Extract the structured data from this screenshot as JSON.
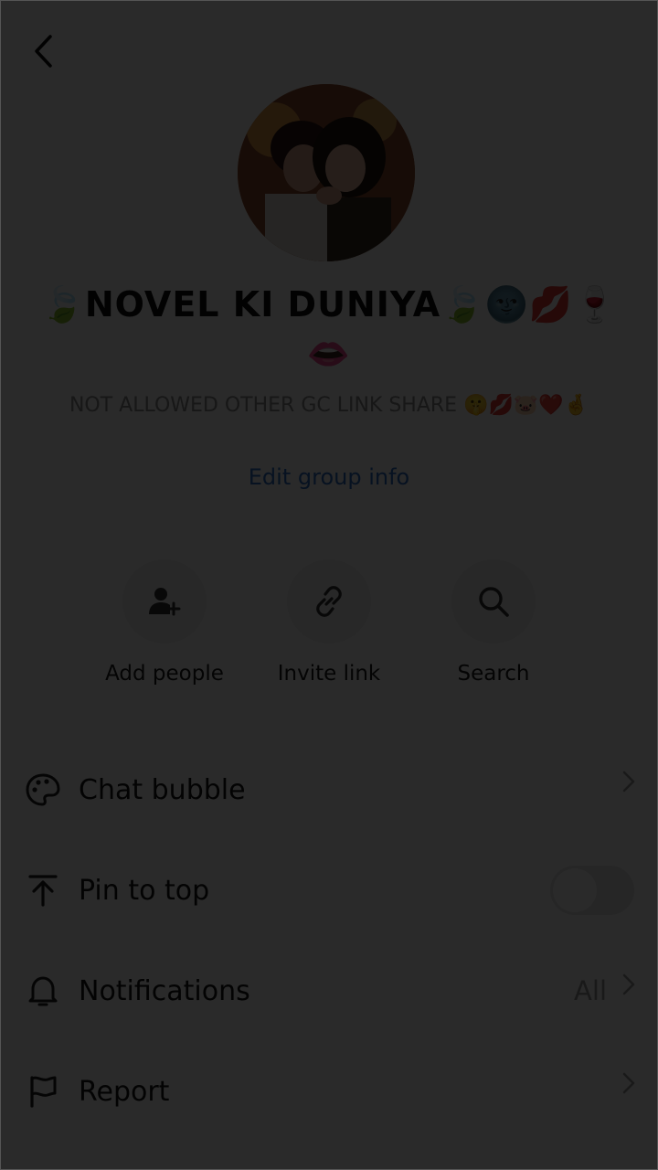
{
  "header": {
    "back_icon": "chevron-left-icon"
  },
  "group": {
    "name": "🍃NOVEL KI DUNIYA🍃🌚💋🍷👄",
    "description": "NOT ALLOWED OTHER GC LINK SHARE 🤫💋🐷❤️🤞",
    "edit_label": "Edit group info"
  },
  "actions": [
    {
      "label": "Add people",
      "icon": "add-person-icon"
    },
    {
      "label": "Invite link",
      "icon": "link-icon"
    },
    {
      "label": "Search",
      "icon": "search-icon"
    }
  ],
  "settings": {
    "chat_bubble": {
      "label": "Chat bubble",
      "icon": "palette-icon"
    },
    "pin_to_top": {
      "label": "Pin to top",
      "icon": "pin-top-icon",
      "enabled": false
    },
    "notifications": {
      "label": "Notifications",
      "icon": "bell-icon",
      "value": "All"
    },
    "report": {
      "label": "Report",
      "icon": "flag-icon"
    }
  },
  "colors": {
    "accent_link": "#2f6fc9",
    "dim_overlay": "rgba(0,0,0,0.835)"
  }
}
